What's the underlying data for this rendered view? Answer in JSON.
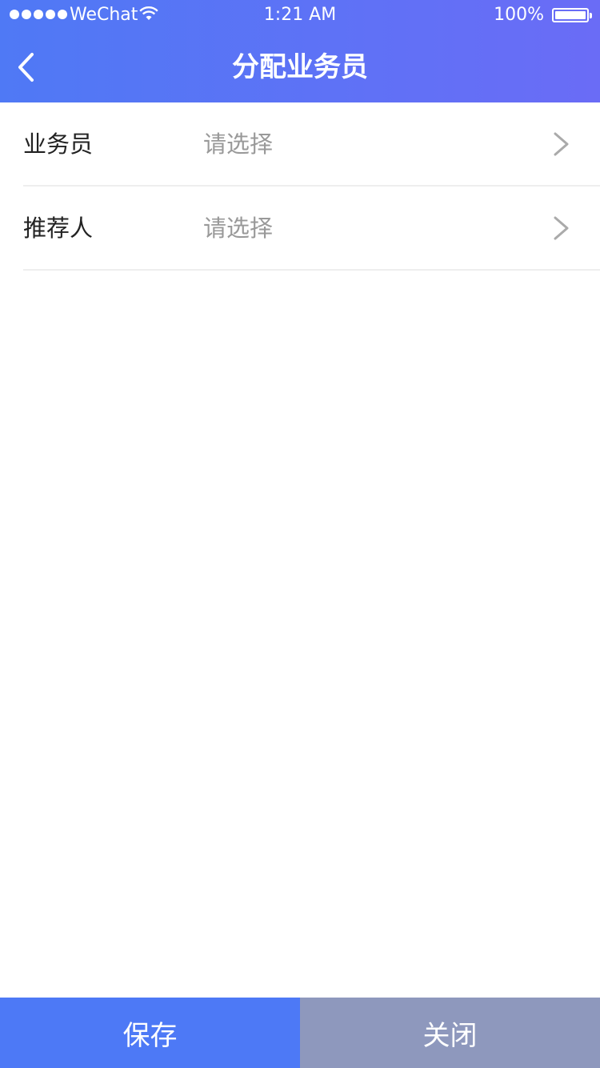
{
  "status_bar": {
    "carrier": "WeChat",
    "time": "1:21 AM",
    "battery": "100%"
  },
  "header": {
    "title": "分配业务员",
    "back_icon": "chevron-left-icon"
  },
  "form": {
    "rows": [
      {
        "label": "业务员",
        "placeholder": "请选择",
        "icon": "chevron-right-icon"
      },
      {
        "label": "推荐人",
        "placeholder": "请选择",
        "icon": "chevron-right-icon"
      }
    ]
  },
  "footer": {
    "save_label": "保存",
    "close_label": "关闭"
  },
  "colors": {
    "header_gradient_start": "#4f79f5",
    "header_gradient_end": "#6a6cf6",
    "save_button": "#4d79f6",
    "close_button": "#8e98bd",
    "placeholder_text": "#999999"
  }
}
